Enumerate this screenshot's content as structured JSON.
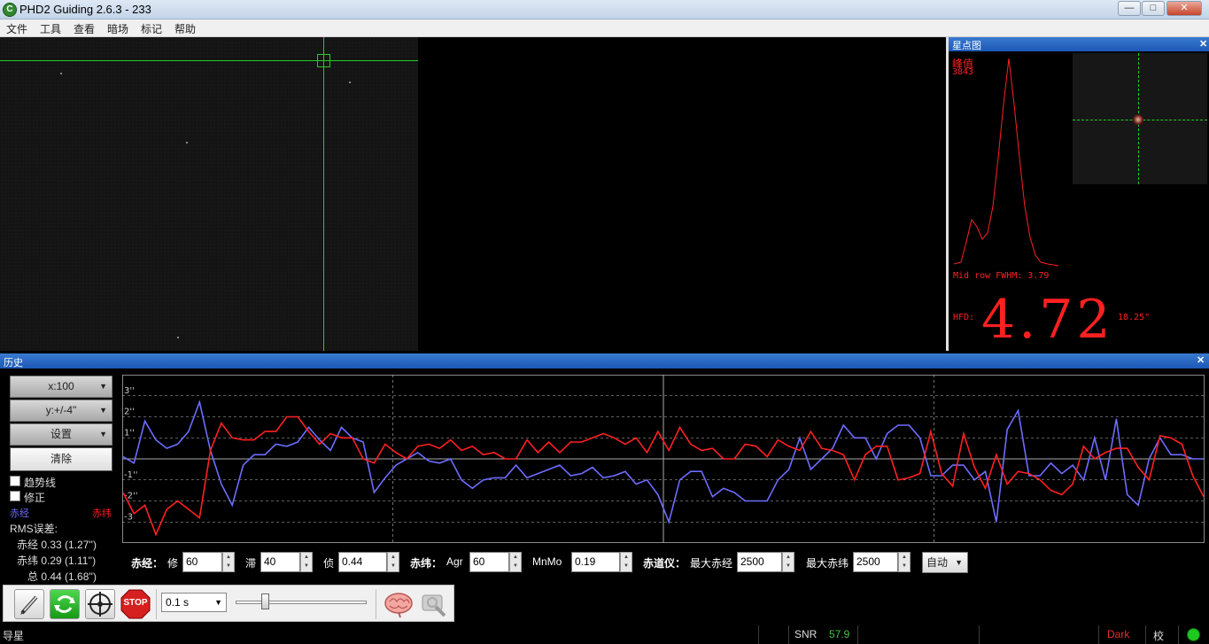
{
  "window": {
    "title": "PHD2 Guiding 2.6.3 - 233",
    "icon_letter": "C"
  },
  "window_buttons": {
    "minimize": "—",
    "maximize": "□",
    "close": "✕"
  },
  "menu": [
    "文件",
    "工具",
    "查看",
    "暗场",
    "标记",
    "帮助"
  ],
  "profile": {
    "title": "星点图",
    "close": "✕",
    "peak_label": "峰值",
    "peak_value": "3843",
    "fwhm_text": "Mid row FWHM: 3.79",
    "hfd_label": "HFD:",
    "hfd_value": "4.72",
    "hfd_arcsec": "18.25\""
  },
  "history": {
    "title": "历史",
    "close": "✕",
    "x_scale": "x:100",
    "y_scale": "y:+/-4\"",
    "settings": "设置",
    "clear": "清除",
    "trend_label": "趋势线",
    "correction_label": "修正",
    "ra_legend": "赤经",
    "dec_legend": "赤纬",
    "rms_title": "RMS误差:",
    "rms_ra": "赤经  0.33 (1.27'')",
    "rms_dec": "赤纬  0.29 (1.11'')",
    "rms_total": "总  0.44 (1.68'')",
    "colors": {
      "ra": "#6d6dff",
      "dec": "#ff2020"
    }
  },
  "guide_params": {
    "ra_section": "赤经：",
    "ra_agr_label": "修",
    "ra_agr_value": "60",
    "ra_hys_label": "滞",
    "ra_hys_value": "40",
    "ra_mnmo_label": "侦",
    "ra_mnmo_value": "0.44",
    "dec_section": "赤纬：",
    "dec_agr_label": "Agr",
    "dec_agr_value": "60",
    "dec_mnmo_label": "MnMo",
    "dec_mnmo_value": "0.19",
    "mount_section": "赤道仪：",
    "max_ra_label": "最大赤经",
    "max_ra_value": "2500",
    "max_dec_label": "最大赤纬",
    "max_dec_value": "2500",
    "dec_mode": "自动"
  },
  "toolbar": {
    "exposure": "0.1 s",
    "stop_label": "STOP",
    "icons": [
      "pencil-icon",
      "loop-icon",
      "crosshair-icon",
      "stop-icon",
      "brain-icon",
      "wrench-icon"
    ]
  },
  "status": {
    "left": "导星",
    "snr_label": "SNR",
    "snr_value": "57.9",
    "dark_label": "Dark",
    "cal_label": "校",
    "colors": {
      "snr": "#3cc83c",
      "dark": "#e03030",
      "connected": "#1ec81e"
    }
  },
  "chart_data": {
    "type": "line",
    "y_ticks": [
      "3''",
      "2''",
      "1''",
      "",
      "-1''",
      "-2''",
      "-3"
    ],
    "ylim": [
      -4,
      4
    ],
    "x_points": 100,
    "series": [
      {
        "name": "赤经",
        "values": [
          0.1,
          -0.2,
          1.8,
          0.9,
          0.5,
          0.7,
          1.3,
          2.7,
          0.4,
          -1.2,
          -2.2,
          -0.3,
          0.2,
          0.2,
          0.7,
          0.6,
          0.8,
          1.5,
          0.9,
          0.4,
          1.5,
          1.0,
          0.8,
          -1.6,
          -0.9,
          -0.3,
          0.0,
          0.3,
          -0.1,
          -0.2,
          0.0,
          -1.0,
          -1.4,
          -1.0,
          -0.9,
          -0.9,
          -0.3,
          -0.9,
          -0.7,
          -0.5,
          -0.3,
          -0.8,
          -0.7,
          -0.4,
          -0.9,
          -0.8,
          -0.6,
          -1.2,
          -1.0,
          -1.7,
          -3.0,
          -1.0,
          -0.6,
          -0.6,
          -1.8,
          -1.4,
          -1.6,
          -2.0,
          -2.0,
          -2.0,
          -1.0,
          -0.5,
          1.0,
          -0.5,
          0.0,
          0.5,
          1.6,
          1.0,
          1.0,
          0.0,
          1.2,
          1.6,
          1.6,
          1.0,
          -0.8,
          -0.8,
          -0.3,
          -0.3,
          -1.0,
          -0.6,
          -3.0,
          1.4,
          2.3,
          -0.8,
          -0.8,
          -0.2,
          -0.7,
          -0.3,
          -1.0,
          1.0,
          -1.0,
          1.9,
          -1.7,
          -2.2,
          0.0,
          1.0,
          0.2,
          0.2,
          0.0,
          0.0
        ],
        "color": "#6d6dff"
      },
      {
        "name": "赤纬",
        "values": [
          -1.6,
          -2.6,
          -2.2,
          -3.6,
          -2.4,
          -2.0,
          -2.4,
          -2.8,
          0.4,
          1.7,
          1.0,
          0.9,
          0.9,
          1.3,
          1.3,
          2.0,
          2.0,
          1.3,
          0.7,
          1.2,
          1.0,
          1.0,
          0.0,
          -0.2,
          0.7,
          0.3,
          0.0,
          0.6,
          0.7,
          0.5,
          0.9,
          0.4,
          0.6,
          0.2,
          0.3,
          0.0,
          0.0,
          0.9,
          0.3,
          0.8,
          0.3,
          0.8,
          0.8,
          1.0,
          1.2,
          1.0,
          0.7,
          1.0,
          0.3,
          1.3,
          0.4,
          1.5,
          0.7,
          0.4,
          0.5,
          0.0,
          0.0,
          0.7,
          0.6,
          0.1,
          0.9,
          0.6,
          0.4,
          1.3,
          0.5,
          0.4,
          0.2,
          -1.0,
          0.2,
          0.6,
          0.6,
          -1.0,
          -0.9,
          -0.7,
          1.3,
          -0.7,
          -1.3,
          1.2,
          -0.4,
          -1.4,
          0.2,
          -1.2,
          -0.6,
          -0.7,
          -1.0,
          -1.5,
          -1.7,
          -1.2,
          0.6,
          0.0,
          0.3,
          0.5,
          0.5,
          -0.4,
          -1.0,
          1.1,
          1.0,
          0.7,
          -0.8,
          -1.8
        ],
        "color": "#ff2020"
      }
    ],
    "grid": true
  }
}
